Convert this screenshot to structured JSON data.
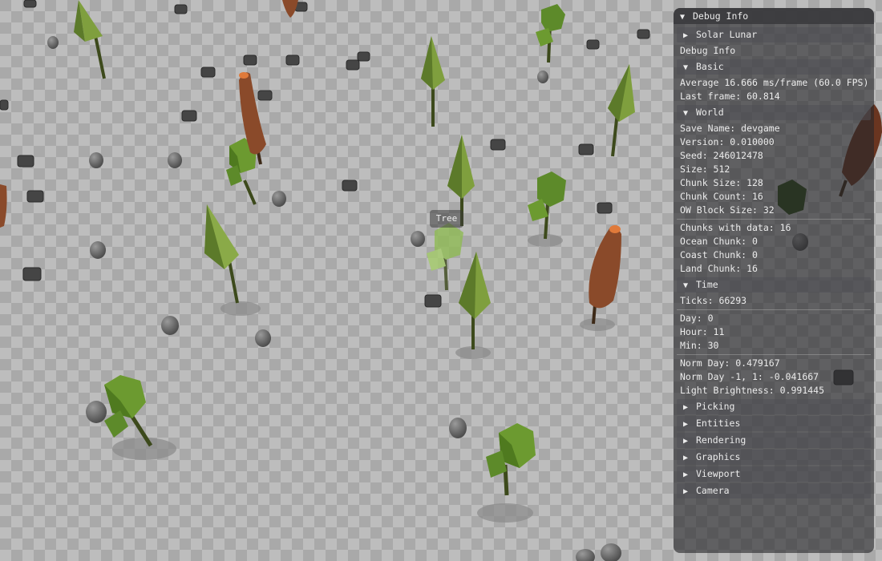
{
  "scene": {
    "tooltip": "Tree",
    "colors": {
      "ground_light": "#bdbdbd",
      "ground_dark": "#a9a9a9",
      "pine_green": "#7f9f3e",
      "round_green": "#5d8a2a",
      "autumn_brown": "#8a4a2a",
      "autumn_tip": "#e07a3a",
      "rock": "#6a6a6a",
      "crate": "#4a4a4a"
    }
  },
  "debug": {
    "title": "Debug Info",
    "solar_lunar": "Solar Lunar",
    "debug_info_label": "Debug Info",
    "basic": {
      "header": "Basic",
      "average": "Average 16.666 ms/frame (60.0 FPS)",
      "last_frame": "Last frame: 60.814"
    },
    "world": {
      "header": "World",
      "save_name": "Save Name: devgame",
      "version": "Version: 0.010000",
      "seed": "Seed: 246012478",
      "size": "Size: 512",
      "chunk_size": "Chunk Size: 128",
      "chunk_count": "Chunk Count: 16",
      "ow_block_size": "OW Block Size: 32",
      "chunks_with_data": "Chunks with data: 16",
      "ocean_chunk": "Ocean Chunk: 0",
      "coast_chunk": "Coast Chunk: 0",
      "land_chunk": "Land Chunk: 16"
    },
    "time": {
      "header": "Time",
      "ticks": "Ticks: 66293",
      "day": "Day: 0",
      "hour": "Hour: 11",
      "min": "Min: 30",
      "norm_day": "Norm Day: 0.479167",
      "norm_day_range": "Norm Day -1, 1: -0.041667",
      "light_brightness": "Light Brightness: 0.991445"
    },
    "sections": [
      "Picking",
      "Entities",
      "Rendering",
      "Graphics",
      "Viewport",
      "Camera"
    ],
    "icons": {
      "expanded": "arrow-down-icon",
      "collapsed": "arrow-right-icon"
    }
  }
}
